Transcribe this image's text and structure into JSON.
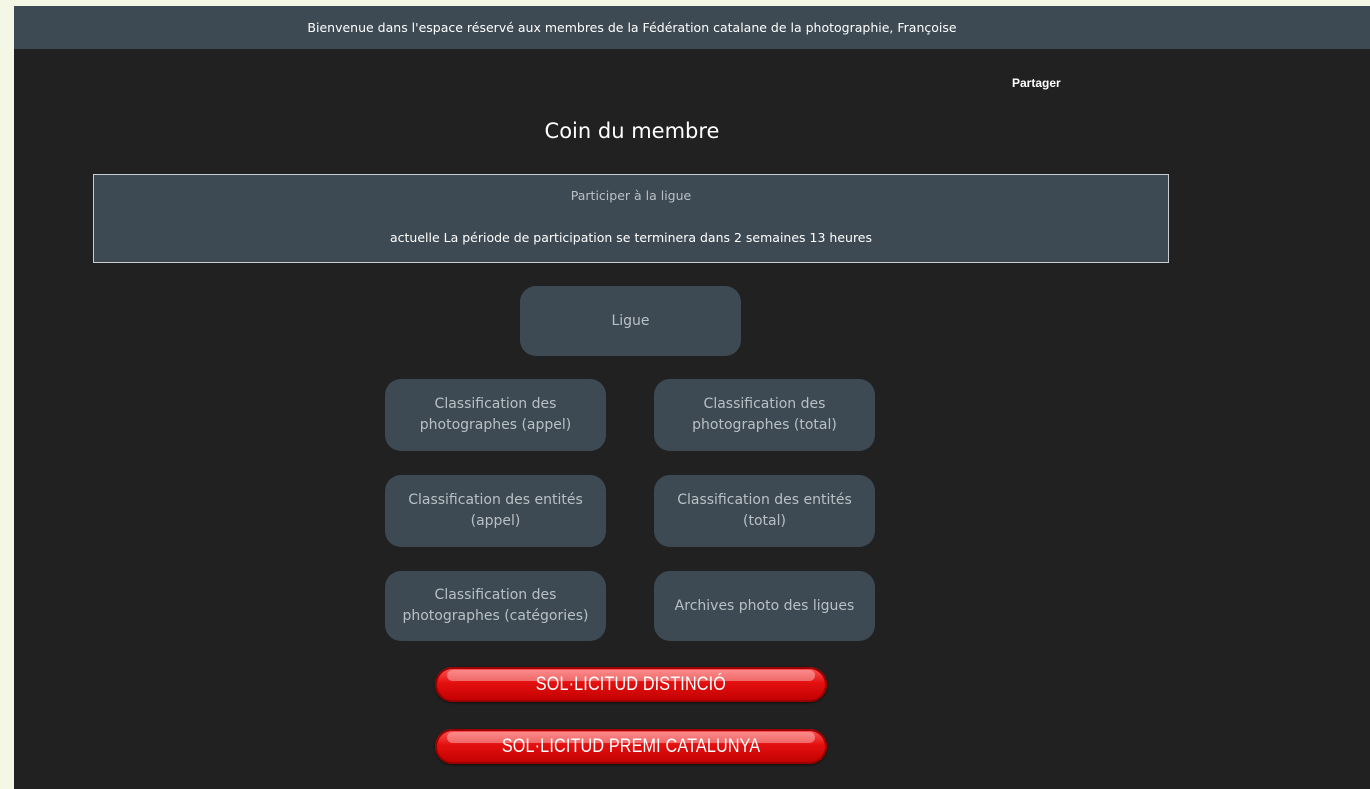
{
  "header": {
    "welcome": "Bienvenue dans l'espace réservé aux membres de la Fédération catalane de la photographie, Françoise",
    "share_label": "Partager"
  },
  "main": {
    "title": "Coin du membre",
    "league": {
      "link": "Participer à la ligue",
      "period": "actuelle La période de participation se terminera dans 2 semaines 13 heures"
    },
    "buttons": {
      "league": "Ligue",
      "photographers_call": "Classification des photographes (appel)",
      "photographers_total": "Classification des photographes (total)",
      "entities_call": "Classification des entités (appel)",
      "entities_total": "Classification des entités (total)",
      "photographers_categories": "Classification des photographes (catégories)",
      "archives": "Archives photo des ligues"
    },
    "requests": {
      "distinction": "SOL·LICITUD DISTINCIÓ",
      "premi": "SOL·LICITUD PREMI CATALUNYA"
    }
  },
  "colors": {
    "page_bg": "#212121",
    "bar_bg": "#3d4a53",
    "accent_red": "#e41010"
  }
}
